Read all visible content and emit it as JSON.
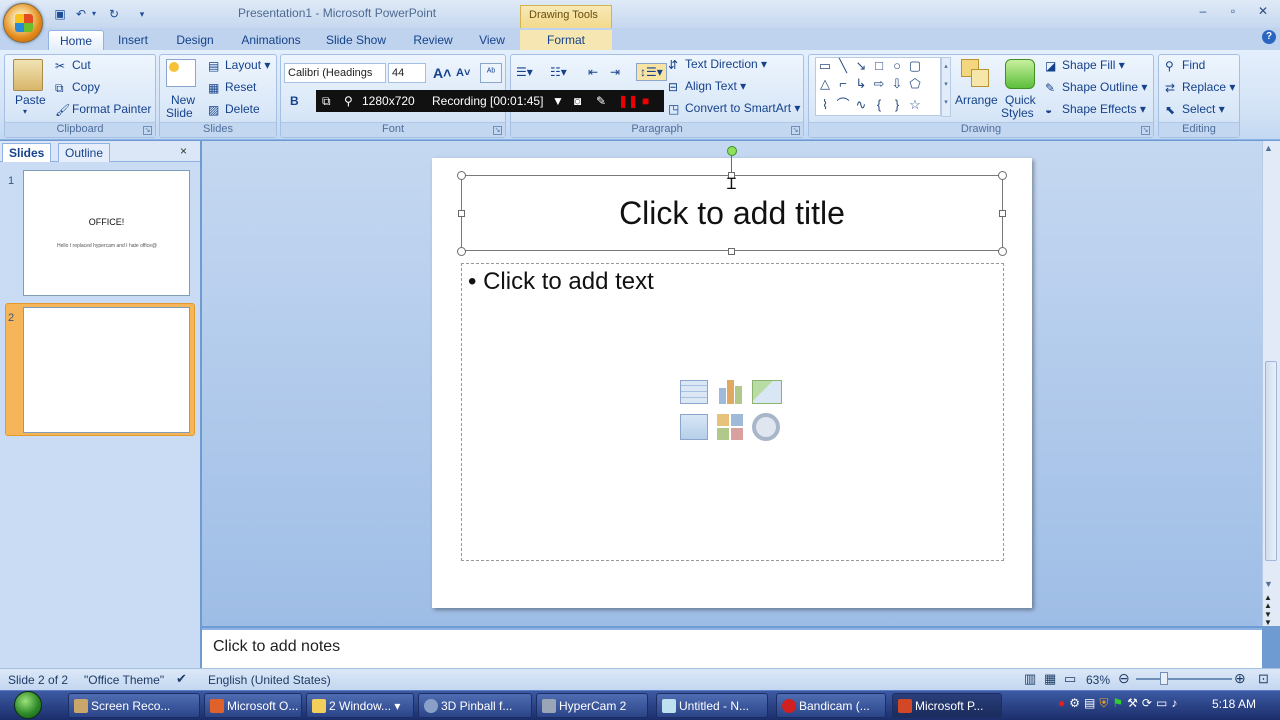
{
  "window": {
    "title": "Presentation1 - Microsoft PowerPoint",
    "contextual_tab_group": "Drawing Tools"
  },
  "ribbon_tabs": [
    "Home",
    "Insert",
    "Design",
    "Animations",
    "Slide Show",
    "Review",
    "View",
    "Format"
  ],
  "clipboard": {
    "paste": "Paste",
    "cut": "Cut",
    "copy": "Copy",
    "format_painter": "Format Painter",
    "label": "Clipboard"
  },
  "slides_group": {
    "new_slide_line1": "New",
    "new_slide_line2": "Slide",
    "layout": "Layout",
    "reset": "Reset",
    "delete": "Delete",
    "label": "Slides"
  },
  "font_group": {
    "font_name": "Calibri (Headings",
    "font_size": "44",
    "label": "Font"
  },
  "paragraph_group": {
    "text_direction": "Text Direction",
    "align_text": "Align Text",
    "convert_smartart": "Convert to SmartArt",
    "label": "Paragraph"
  },
  "drawing_group": {
    "arrange": "Arrange",
    "quick_styles_line1": "Quick",
    "quick_styles_line2": "Styles",
    "shape_fill": "Shape Fill",
    "shape_outline": "Shape Outline",
    "shape_effects": "Shape Effects",
    "label": "Drawing"
  },
  "editing_group": {
    "find": "Find",
    "replace": "Replace",
    "select": "Select",
    "label": "Editing"
  },
  "recorder": {
    "resolution": "1280x720",
    "status": "Recording [00:01:45]"
  },
  "panel": {
    "tab_slides": "Slides",
    "tab_outline": "Outline",
    "close": "×",
    "slides": [
      {
        "number": "1",
        "title": "OFFICE!",
        "subtitle": "Hello I replaced hypercam and I hate office@"
      },
      {
        "number": "2"
      }
    ]
  },
  "slide": {
    "title_placeholder": "Click to add title",
    "body_placeholder": "Click to add text"
  },
  "notes": {
    "placeholder": "Click to add notes"
  },
  "status": {
    "slide_count": "Slide 2 of 2",
    "theme": "\"Office Theme\"",
    "language": "English (United States)",
    "zoom": "63%"
  },
  "taskbar": {
    "items": [
      "Screen Reco...",
      "Microsoft O...",
      "2 Window...",
      "3D Pinball f...",
      "HyperCam 2",
      "Untitled - N...",
      "Bandicam (...",
      "Microsoft P..."
    ],
    "clock": "5:18 AM"
  },
  "colors": {
    "accent": "#15428b",
    "ribbon": "#d2e2f6",
    "selection": "#f7b55a",
    "taskbar": "#2b4488"
  }
}
